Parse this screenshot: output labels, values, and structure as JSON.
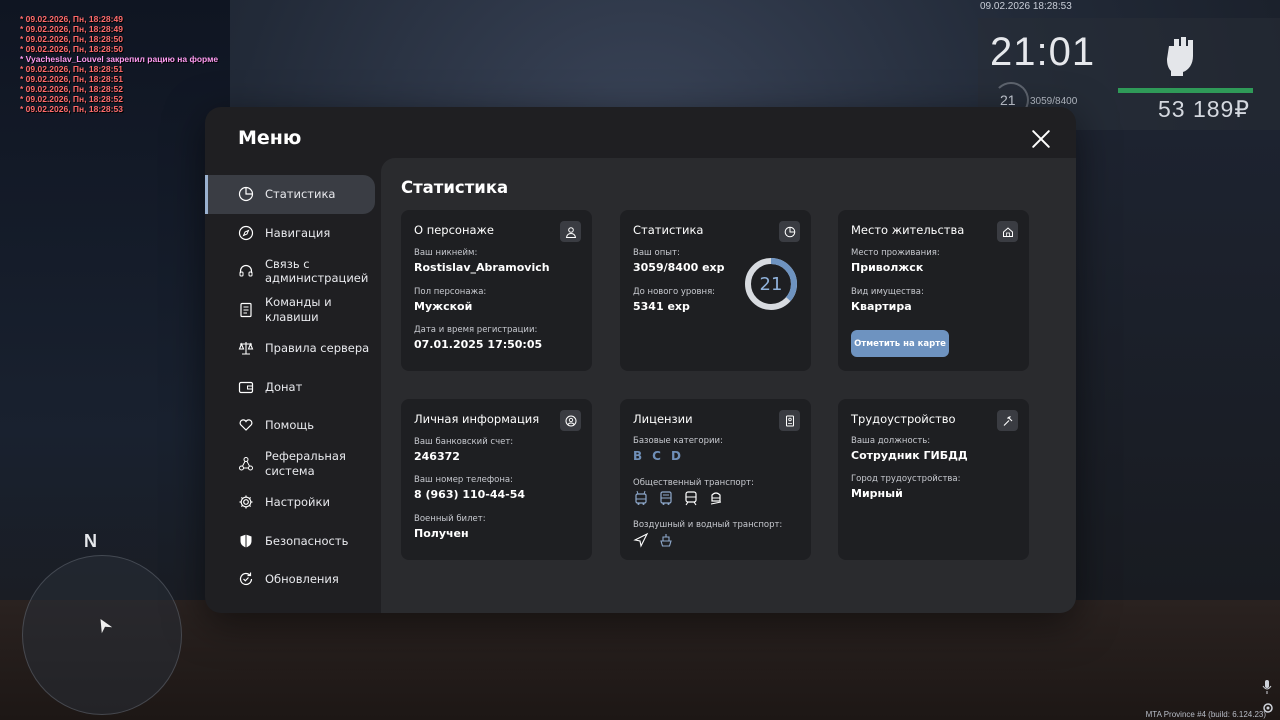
{
  "chat": [
    {
      "text": "* 09.02.2026, Пн, 18:28:49",
      "sys": false
    },
    {
      "text": "* 09.02.2026, Пн, 18:28:49",
      "sys": false
    },
    {
      "text": "* 09.02.2026, Пн, 18:28:50",
      "sys": false
    },
    {
      "text": "* 09.02.2026, Пн, 18:28:50",
      "sys": false
    },
    {
      "text": "* Vyacheslav_Louvel закрепил рацию на форме",
      "sys": true
    },
    {
      "text": "* 09.02.2026, Пн, 18:28:51",
      "sys": false
    },
    {
      "text": "* 09.02.2026, Пн, 18:28:51",
      "sys": false
    },
    {
      "text": "* 09.02.2026, Пн, 18:28:52",
      "sys": false
    },
    {
      "text": "* 09.02.2026, Пн, 18:28:52",
      "sys": false
    },
    {
      "text": "* 09.02.2026, Пн, 18:28:53",
      "sys": false
    }
  ],
  "hud": {
    "datetime": "09.02.2026 18:28:53",
    "clock": "21:01",
    "level": "21",
    "exp": "3059/8400",
    "money": "53 189₽",
    "fist_icon": "fist-icon",
    "health_color": "#2f9a58"
  },
  "minimap": {
    "north": "N"
  },
  "build": "MTA Province #4 (build: 6.124.23)",
  "menu": {
    "title": "Меню",
    "nav": [
      {
        "label": "Статистика",
        "icon": "chart-pie-icon",
        "active": true
      },
      {
        "label": "Навигация",
        "icon": "compass-icon",
        "active": false
      },
      {
        "label": "Связь с\nадминистрацией",
        "icon": "headset-icon",
        "active": false
      },
      {
        "label": "Команды и\nклавиши",
        "icon": "document-icon",
        "active": false
      },
      {
        "label": "Правила сервера",
        "icon": "scales-icon",
        "active": false
      },
      {
        "label": "Донат",
        "icon": "wallet-icon",
        "active": false
      },
      {
        "label": "Помощь",
        "icon": "heart-hand-icon",
        "active": false
      },
      {
        "label": "Реферальная\nсистема",
        "icon": "network-icon",
        "active": false
      },
      {
        "label": "Настройки",
        "icon": "gear-icon",
        "active": false
      },
      {
        "label": "Безопасность",
        "icon": "shield-icon",
        "active": false
      },
      {
        "label": "Обновления",
        "icon": "refresh-icon",
        "active": false
      }
    ],
    "content_title": "Статистика",
    "cards": {
      "character": {
        "title": "О персонаже",
        "nickname_label": "Ваш никнейм:",
        "nickname": "Rostislav_Abramovich",
        "gender_label": "Пол персонажа:",
        "gender": "Мужской",
        "reg_label": "Дата и время регистрации:",
        "reg": "07.01.2025 17:50:05"
      },
      "stats": {
        "title": "Статистика",
        "exp_label": "Ваш опыт:",
        "exp": "3059/8400 exp",
        "next_label": "До нового уровня:",
        "next": "5341 exp",
        "level": "21",
        "progress": 0.364,
        "ring_color": "#6e93c0"
      },
      "residence": {
        "title": "Место жительства",
        "place_label": "Место проживания:",
        "place": "Приволжск",
        "property_label": "Вид имущества:",
        "property": "Квартира",
        "button": "Отметить на карте"
      },
      "personal": {
        "title": "Личная информация",
        "bank_label": "Ваш банковский счет:",
        "bank": "246372",
        "phone_label": "Ваш номер телефона:",
        "phone": "8 (963) 110-44-54",
        "military_label": "Военный билет:",
        "military": "Получен"
      },
      "licenses": {
        "title": "Лицензии",
        "base_label": "Базовые категории:",
        "base": [
          "B",
          "C",
          "D"
        ],
        "public_label": "Общественный транспорт:",
        "public_icons": [
          "trolleybus-icon",
          "bus-icon",
          "train-icon",
          "tram-icon"
        ],
        "air_label": "Воздушный и водный транспорт:",
        "air_icons": [
          "plane-icon",
          "boat-icon"
        ]
      },
      "job": {
        "title": "Трудоустройство",
        "position_label": "Ваша должность:",
        "position": "Сотрудник ГИБДД",
        "city_label": "Город трудоустройства:",
        "city": "Мирный"
      }
    }
  }
}
